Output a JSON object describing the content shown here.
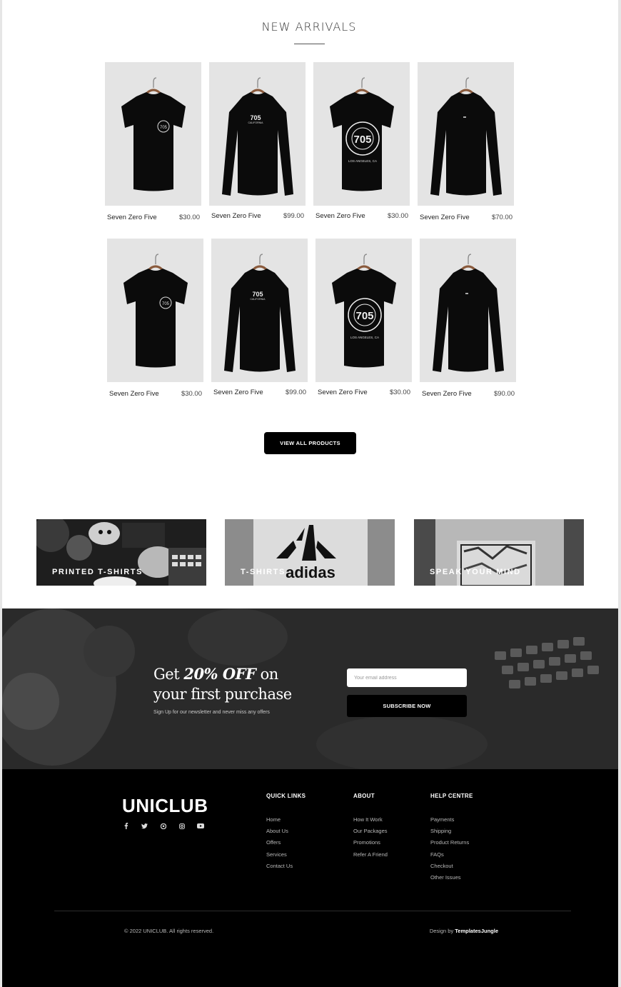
{
  "new_arrivals": {
    "title": "NEW ARRIVALS",
    "rows": [
      [
        {
          "name": "Seven Zero Five",
          "price": "$30.00",
          "shirt": "tee-small-logo"
        },
        {
          "name": "Seven Zero Five",
          "price": "$99.00",
          "shirt": "longsleeve-705-text"
        },
        {
          "name": "Seven Zero Five",
          "price": "$30.00",
          "shirt": "tee-big-circle-logo"
        },
        {
          "name": "Seven Zero Five",
          "price": "$70.00",
          "shirt": "longsleeve-plain"
        }
      ],
      [
        {
          "name": "Seven Zero Five",
          "price": "$30.00",
          "shirt": "tee-small-logo"
        },
        {
          "name": "Seven Zero Five",
          "price": "$99.00",
          "shirt": "longsleeve-705-text"
        },
        {
          "name": "Seven Zero Five",
          "price": "$30.00",
          "shirt": "tee-big-circle-logo"
        },
        {
          "name": "Seven Zero Five",
          "price": "$90.00",
          "shirt": "longsleeve-plain"
        }
      ]
    ],
    "view_all_label": "VIEW ALL PRODUCTS"
  },
  "categories": [
    {
      "label": "PRINTED T-SHIRTS"
    },
    {
      "label": "T-SHIRTS",
      "image_text": "adidas"
    },
    {
      "label": "SPEAK YOUR MIND"
    }
  ],
  "newsletter": {
    "headline_pre": "Get ",
    "headline_em": "20% OFF",
    "headline_post": " on",
    "headline_line2": "your first purchase",
    "subtext": "Sign Up for our newsletter and never miss any offers",
    "email_placeholder": "Your email address",
    "subscribe_label": "SUBSCRIBE NOW"
  },
  "footer": {
    "logo": "UNICLUB",
    "social_icons": [
      "facebook-icon",
      "twitter-icon",
      "pinterest-icon",
      "instagram-icon",
      "youtube-icon"
    ],
    "columns": [
      {
        "heading": "QUICK LINKS",
        "links": [
          "Home",
          "About Us",
          "Offers",
          "Services",
          "Contact Us"
        ]
      },
      {
        "heading": "ABOUT",
        "links": [
          "How It Work",
          "Our Packages",
          "Promotions",
          "Refer A Friend"
        ]
      },
      {
        "heading": "HELP CENTRE",
        "links": [
          "Payments",
          "Shipping",
          "Product Returns",
          "FAQs",
          "Checkout",
          "Other Issues"
        ]
      }
    ],
    "copyright": "© 2022 UNICLUB. All rights reserved.",
    "design_by_prefix": "Design by ",
    "design_by_name": "TemplatesJungle"
  },
  "colors": {
    "accent": "#000000",
    "muted_text": "#b9b9b9",
    "product_bg": "#e4e4e4"
  }
}
